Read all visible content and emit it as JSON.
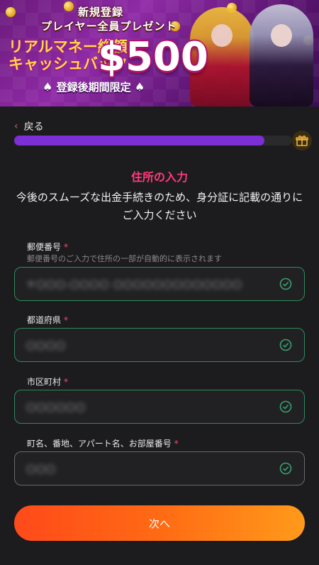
{
  "banner": {
    "line1": "新規登録",
    "line2": "プレイヤー全員プレゼント",
    "line3": "リアルマネー総額",
    "line4": "キャッシュバック",
    "amount": "$500",
    "limited": "登録後期間限定"
  },
  "nav": {
    "back_label": "戻る"
  },
  "progress": {
    "value_percent": 90
  },
  "section": {
    "title": "住所の入力",
    "subtitle": "今後のスムーズな出金手続きのため、身分証に記載の通りにご入力ください"
  },
  "fields": [
    {
      "label": "郵便番号",
      "required": "*",
      "hint": "郵便番号のご入力で住所の一部が自動的に表示されます",
      "value": "〒〇〇〇-〇〇〇〇 〇〇〇〇〇〇〇〇〇〇〇〇〇"
    },
    {
      "label": "都道府県",
      "required": "*",
      "value": "〇〇〇〇"
    },
    {
      "label": "市区町村",
      "required": "*",
      "value": "〇〇〇〇〇〇"
    },
    {
      "label": "町名、番地、アパート名、お部屋番号",
      "required": "*",
      "value": "〇〇〇"
    }
  ],
  "actions": {
    "next_label": "次へ"
  },
  "colors": {
    "accent_title": "#ff3a7a",
    "progress": "#7b2fd4",
    "valid_border": "#2f8a5a",
    "button_gradient_start": "#ff4a1a",
    "button_gradient_end": "#ff9a1a"
  }
}
